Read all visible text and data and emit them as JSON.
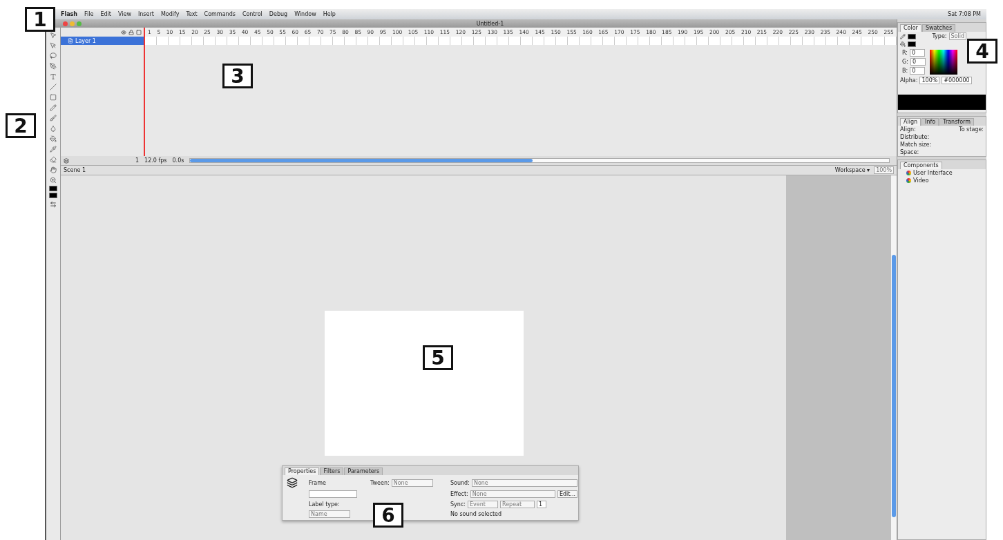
{
  "callouts": [
    "1",
    "2",
    "3",
    "4",
    "5",
    "6"
  ],
  "menu_bar": {
    "items": [
      "Flash",
      "File",
      "Edit",
      "View",
      "Insert",
      "Modify",
      "Text",
      "Commands",
      "Control",
      "Debug",
      "Window",
      "Help"
    ],
    "clock": "Sat 7:08 PM"
  },
  "window": {
    "title": "Untitled-1"
  },
  "tools": [
    {
      "kind": "select"
    },
    {
      "kind": "subselect"
    },
    {
      "kind": "lasso"
    },
    {
      "kind": "pen"
    },
    {
      "kind": "text"
    },
    {
      "kind": "line"
    },
    {
      "kind": "rect"
    },
    {
      "kind": "pencil"
    },
    {
      "kind": "brush"
    },
    {
      "kind": "ink"
    },
    {
      "kind": "bucket"
    },
    {
      "kind": "dropper"
    },
    {
      "kind": "eraser"
    },
    {
      "kind": "hand"
    },
    {
      "kind": "zoom"
    },
    {
      "kind": "stroke"
    },
    {
      "kind": "fill"
    },
    {
      "kind": "swap"
    }
  ],
  "timeline": {
    "frame_numbers": [
      "1",
      "5",
      "10",
      "15",
      "20",
      "25",
      "30",
      "35",
      "40",
      "45",
      "50",
      "55",
      "60",
      "65",
      "70",
      "75",
      "80",
      "85",
      "90",
      "95",
      "100",
      "105",
      "110",
      "115",
      "120",
      "125",
      "130",
      "135",
      "140",
      "145",
      "150",
      "155",
      "160",
      "165",
      "170",
      "175",
      "180",
      "185",
      "190",
      "195",
      "200",
      "205",
      "210",
      "215",
      "220",
      "225",
      "230",
      "235",
      "240",
      "245",
      "250",
      "255"
    ],
    "layers": [
      {
        "name": "Layer 1",
        "selected": true
      }
    ],
    "current_frame": "1",
    "frame_rate": "12.0 fps",
    "elapsed": "0.0s"
  },
  "edit_bar": {
    "scene": "Scene 1",
    "workspace": "Workspace ▾",
    "zoom": "100%"
  },
  "color_panel": {
    "tabs": [
      {
        "label": "Color",
        "selected": true
      },
      {
        "label": "Swatches",
        "selected": false
      }
    ],
    "type_label": "Type:",
    "type": "Solid",
    "channels": [
      {
        "label": "R:",
        "value": "0"
      },
      {
        "label": "G:",
        "value": "0"
      },
      {
        "label": "B:",
        "value": "0"
      }
    ],
    "alpha_label": "Alpha:",
    "alpha": "100%",
    "hex": "#000000"
  },
  "align_panel": {
    "tabs": [
      {
        "label": "Align",
        "selected": true
      },
      {
        "label": "Info",
        "selected": false
      },
      {
        "label": "Transform",
        "selected": false
      }
    ],
    "groups": [
      "Align:",
      "Distribute:",
      "Match size:",
      "Space:"
    ],
    "to_stage": "To stage:"
  },
  "components_panel": {
    "title": "Components",
    "items": [
      "User Interface",
      "Video"
    ]
  },
  "properties_panel": {
    "tabs": [
      {
        "label": "Properties",
        "selected": true
      },
      {
        "label": "Filters",
        "selected": false
      },
      {
        "label": "Parameters",
        "selected": false
      }
    ],
    "frame_label": "Frame",
    "tween_label": "Tween:",
    "tween": "None",
    "label_type_label": "Label type:",
    "label_type": "Name",
    "sound_label": "Sound:",
    "sound": "None",
    "effect_label": "Effect:",
    "effect": "None",
    "edit_button": "Edit...",
    "sync_label": "Sync:",
    "sync": "Event",
    "repeat": "Repeat",
    "repeat_count": "1",
    "status": "No sound selected"
  }
}
